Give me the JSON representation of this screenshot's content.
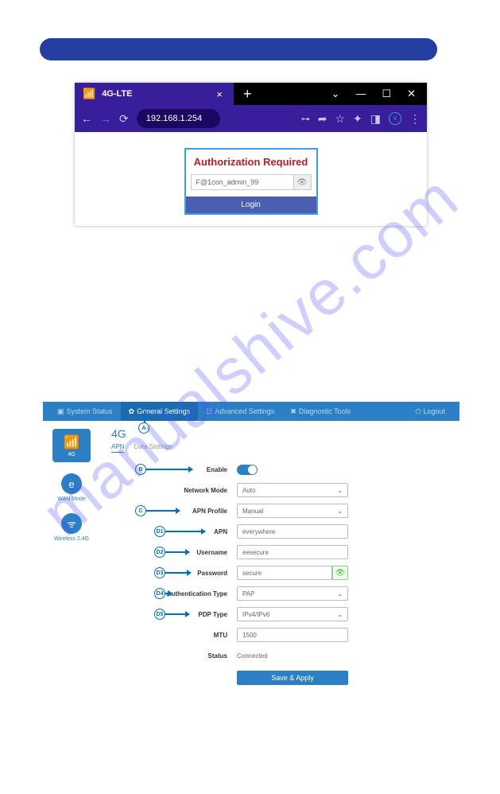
{
  "watermark": "manualshive.com",
  "browser": {
    "tab_title": "4G-LTE",
    "url": "192.168.1.254"
  },
  "login": {
    "header": "Authorization Required",
    "password_value": "F@1con_admin_99",
    "button": "Login"
  },
  "router": {
    "nav": {
      "status": "System Status",
      "general": "General Settings",
      "advanced": "Advanced Settings",
      "diag": "Diagnostic Tools",
      "logout": "Logout"
    },
    "side": {
      "g4": "4G",
      "wan": "WAN Mode",
      "wifi": "Wireless 2.4G"
    },
    "title": "4G",
    "tabs": {
      "apn": "APN",
      "data": "Data Settings"
    },
    "labels": {
      "enable": "Enable",
      "network_mode": "Network Mode",
      "apn_profile": "APN Profile",
      "apn": "APN",
      "username": "Username",
      "password": "Password",
      "auth_type": "Authentication Type",
      "pdp_type": "PDP Type",
      "mtu": "MTU",
      "status": "Status"
    },
    "values": {
      "network_mode": "Auto",
      "apn_profile": "Manual",
      "apn": "everywhere",
      "username": "eesecure",
      "password": "secure",
      "auth_type": "PAP",
      "pdp_type": "IPv4/IPv6",
      "mtu": "1500",
      "status": "Connected"
    },
    "save": "Save & Apply",
    "annot": {
      "a": "A",
      "b": "B",
      "c": "C",
      "d1": "D1",
      "d2": "D2",
      "d3": "D3",
      "d4": "D4",
      "d5": "D5"
    }
  }
}
